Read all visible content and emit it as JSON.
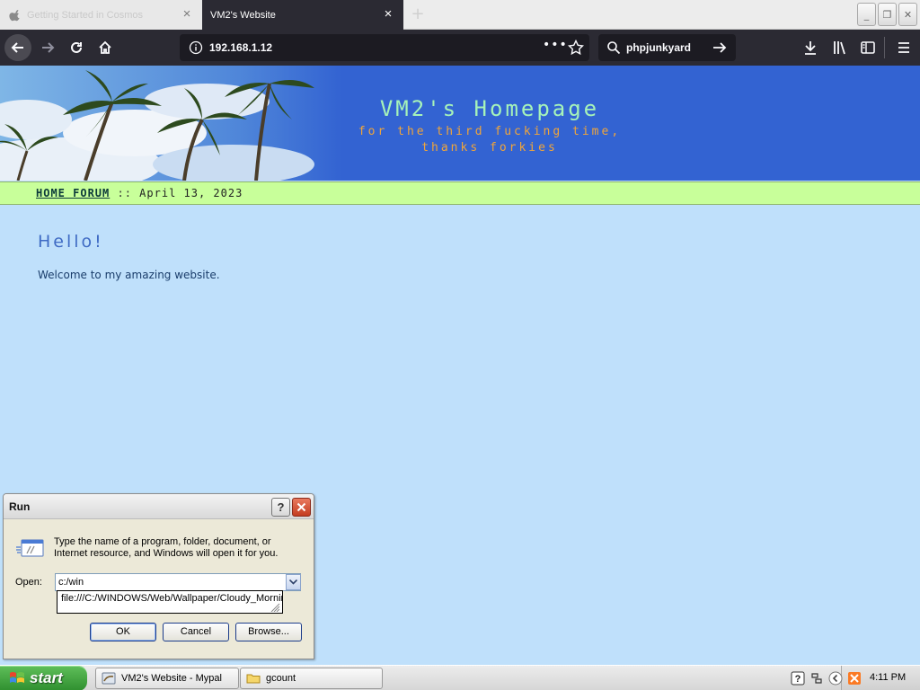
{
  "browser": {
    "tabs": [
      {
        "label": "Getting Started in Cosmos",
        "active": false
      },
      {
        "label": "VM2's Website",
        "active": true
      }
    ],
    "url": "192.168.1.12",
    "search_value": "phpjunkyard",
    "accent": "#2b2a33"
  },
  "page": {
    "site_title": "VM2's Homepage",
    "site_subtitle": "for the third fucking time, thanks forkies",
    "nav": {
      "link": "HOME FORUM",
      "separator": "::",
      "date": "April 13, 2023"
    },
    "heading": "Hello!",
    "body_text": "Welcome to my amazing website.",
    "colors": {
      "header_bg": "#3363d2",
      "title": "#a6f3b9",
      "subtitle": "#f0a53a",
      "nav_bg": "#c8ff9a",
      "page_bg": "#bfe0fb"
    }
  },
  "run_dialog": {
    "title": "Run",
    "help_label": "?",
    "description": "Type the name of a program, folder, document, or Internet resource, and Windows will open it for you.",
    "open_label": "Open:",
    "open_value": "c:/win",
    "suggestion": "file:///C:/WINDOWS/Web/Wallpaper/Cloudy_Morning.jpg",
    "ok_label": "OK",
    "cancel_label": "Cancel",
    "browse_label": "Browse..."
  },
  "taskbar": {
    "start_label": "start",
    "items": [
      {
        "label": "VM2's Website - Mypal",
        "icon": "browser-icon"
      },
      {
        "label": "gcount",
        "icon": "folder-icon"
      }
    ],
    "clock": "4:11 PM"
  }
}
